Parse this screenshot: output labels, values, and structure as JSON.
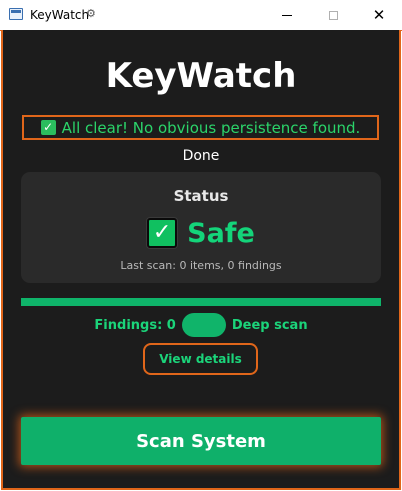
{
  "window": {
    "title": "KeyWatch",
    "title_icon": "gear-icon",
    "controls": {
      "minimize": "minimize",
      "maximize": "maximize",
      "close": "✕"
    }
  },
  "header": {
    "app_title": "KeyWatch"
  },
  "banner": {
    "text": "All clear! No obvious persistence found.",
    "icon": "checkmark-icon"
  },
  "progress": {
    "label": "Done",
    "fraction": 1.0
  },
  "status_card": {
    "heading": "Status",
    "value": "Safe",
    "icon": "checkmark-icon",
    "last_scan": "Last scan: 0 items, 0 findings"
  },
  "findings": {
    "label": "Findings: 0",
    "toggle_label": "Deep scan",
    "toggle_on": true
  },
  "buttons": {
    "view_details": "View details",
    "scan_system": "Scan System"
  },
  "colors": {
    "accent_orange": "#e0661a",
    "success_green": "#14d47a",
    "button_green": "#0fb06a",
    "background": "#1c1c1c",
    "card": "#2a2a2a"
  }
}
